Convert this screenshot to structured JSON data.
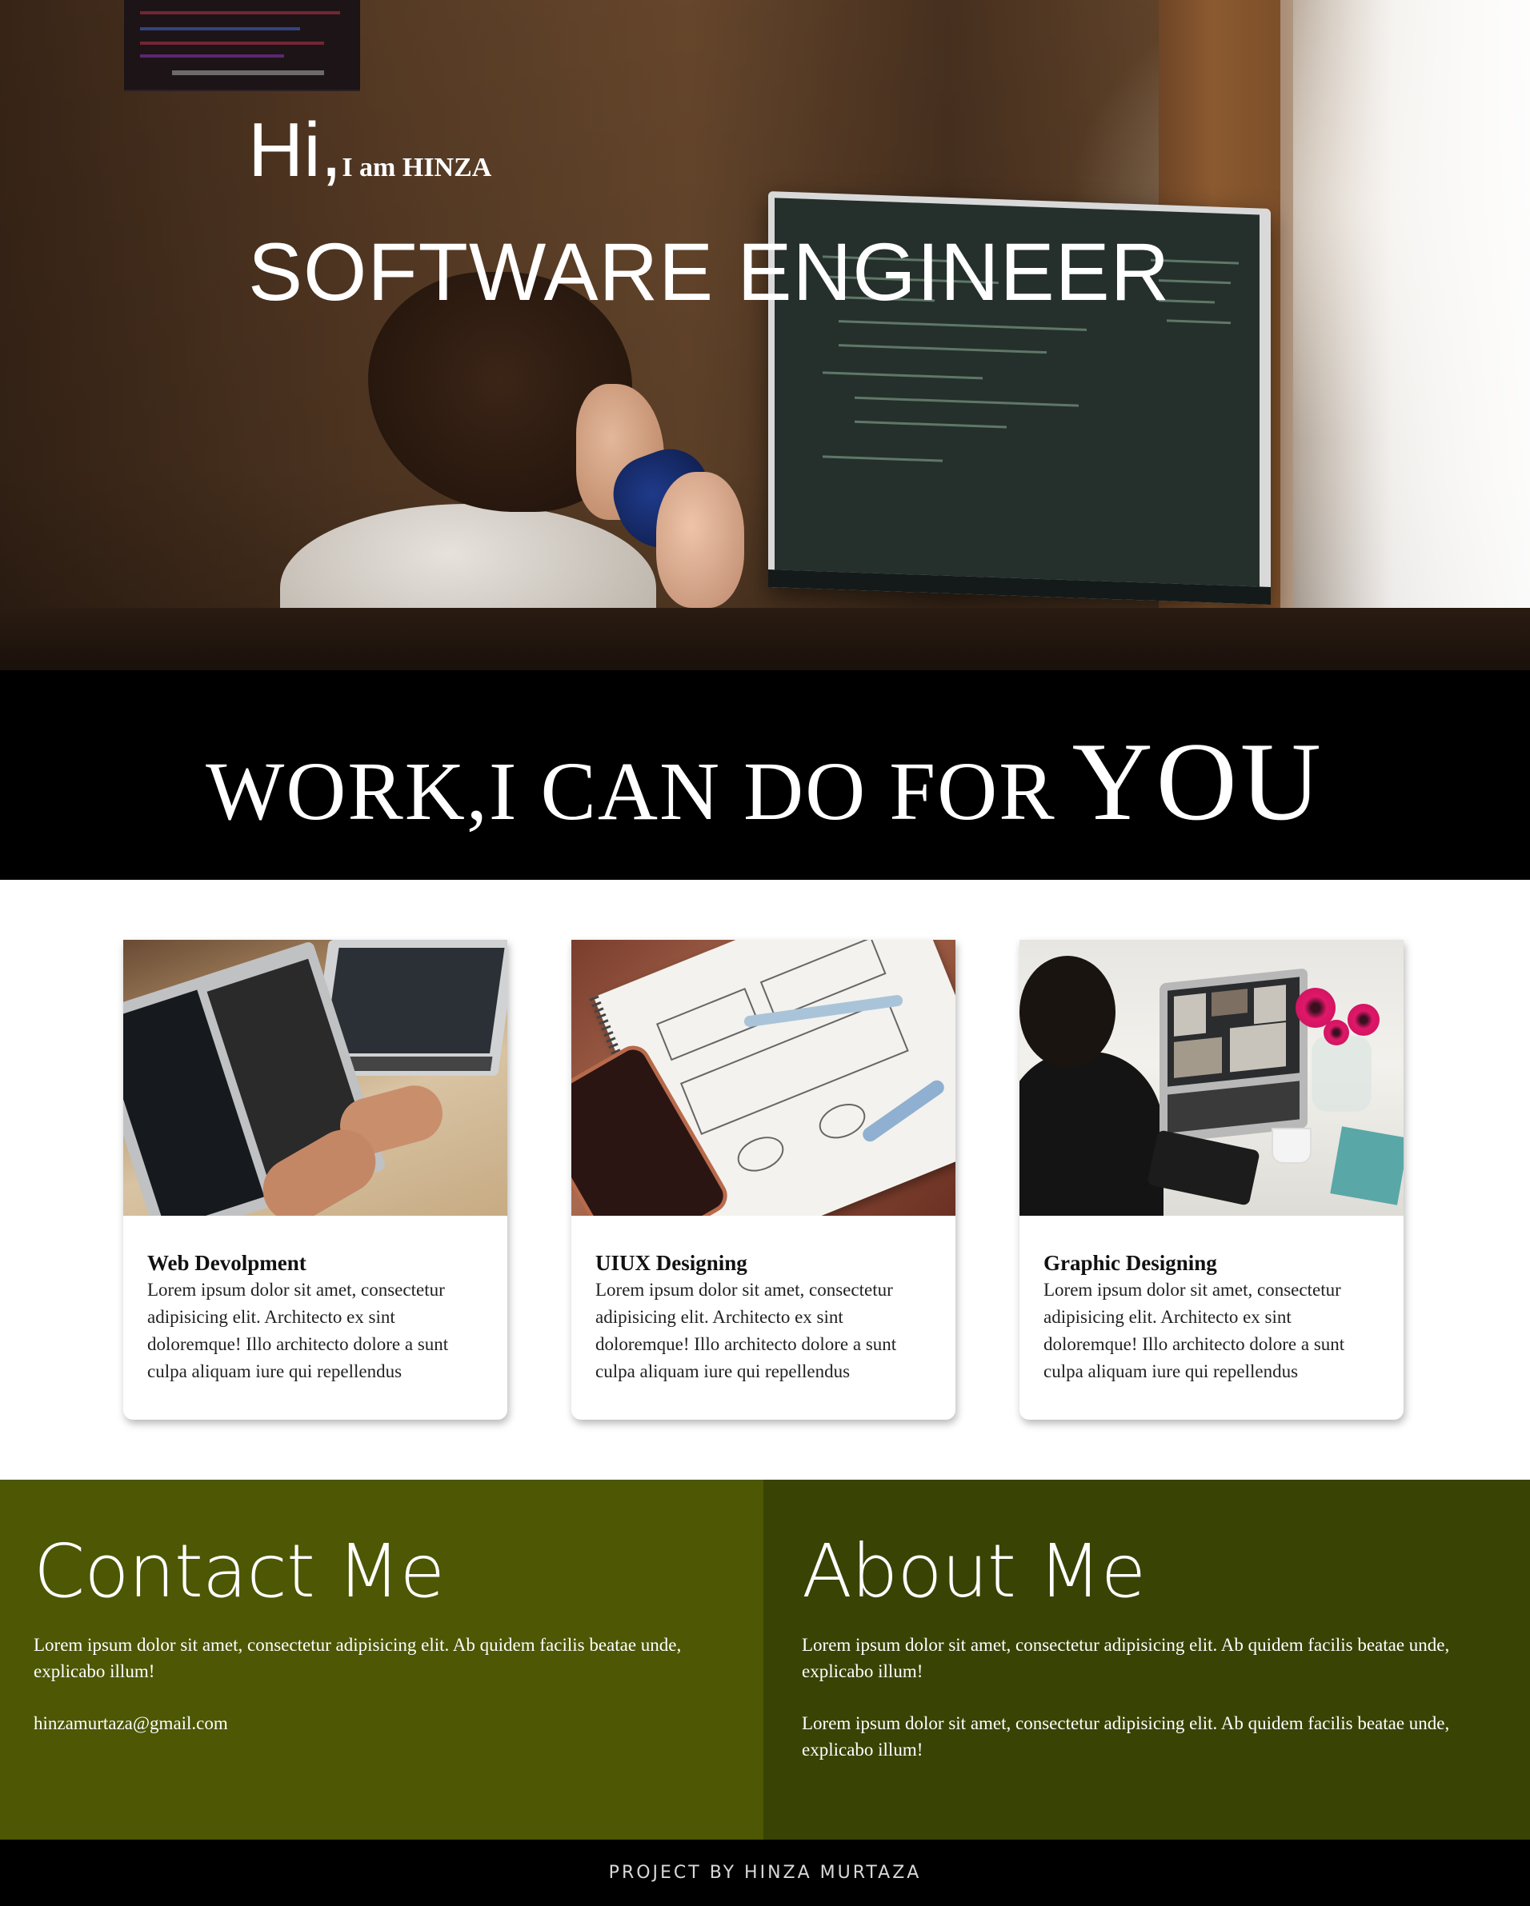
{
  "hero": {
    "greeting": "Hi,",
    "intro": "I am HINZA",
    "role": "SOFTWARE ENGINEER",
    "image_description_icon": "developer-at-computer-photo"
  },
  "banner": {
    "main": "WORK,I CAN DO FOR",
    "emphasis": "YOU"
  },
  "services": [
    {
      "title": "Web Devolpment",
      "text": "Lorem ipsum dolor sit amet, consectetur adipisicing elit. Architecto ex sint doloremque! Illo architecto dolore a sunt culpa aliquam iure qui repellendus",
      "image_icon": "laptops-coding-photo"
    },
    {
      "title": "UIUX Designing",
      "text": "Lorem ipsum dolor sit amet, consectetur adipisicing elit. Architecto ex sint doloremque! Illo architecto dolore a sunt culpa aliquam iure qui repellendus",
      "image_icon": "wireframe-notebook-photo"
    },
    {
      "title": "Graphic Designing",
      "text": "Lorem ipsum dolor sit amet, consectetur adipisicing elit. Architecto ex sint doloremque! Illo architecto dolore a sunt culpa aliquam iure qui repellendus",
      "image_icon": "designer-at-laptop-photo"
    }
  ],
  "contact": {
    "heading": "Contact Me",
    "text": "Lorem ipsum dolor sit amet, consectetur adipisicing elit. Ab quidem facilis beatae unde, explicabo illum!",
    "email": "hinzamurtaza@gmail.com"
  },
  "about": {
    "heading": "About Me",
    "paragraphs": [
      "Lorem ipsum dolor sit amet, consectetur adipisicing elit. Ab quidem facilis beatae unde, explicabo illum!",
      "Lorem ipsum dolor sit amet, consectetur adipisicing elit. Ab quidem facilis beatae unde, explicabo illum!"
    ]
  },
  "footer": {
    "text": "PROJECT BY HINZA MURTAZA"
  },
  "colors": {
    "contact_bg": "#4d5704",
    "about_bg": "#394304",
    "banner_bg": "#000000",
    "footer_bg": "#000000",
    "text_light": "#ffffff"
  }
}
